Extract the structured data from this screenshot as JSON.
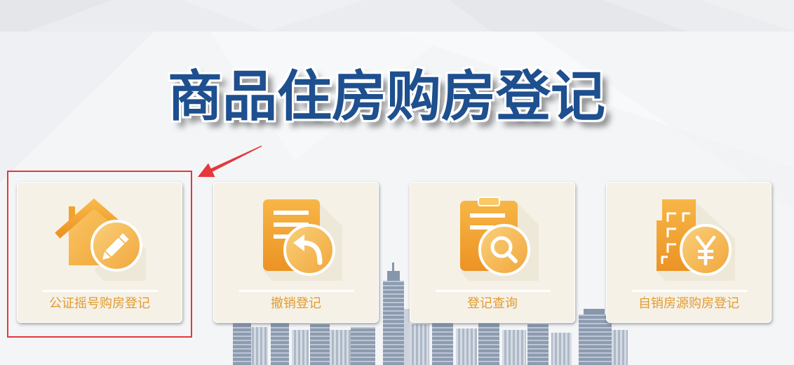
{
  "page": {
    "title": "商品住房购房登记"
  },
  "cards": [
    {
      "label": "公证摇号购房登记",
      "icon": "house-edit-icon",
      "highlighted": true
    },
    {
      "label": "撤销登记",
      "icon": "document-undo-icon",
      "highlighted": false
    },
    {
      "label": "登记查询",
      "icon": "clipboard-search-icon",
      "highlighted": false
    },
    {
      "label": "自销房源购房登记",
      "icon": "building-yuan-icon",
      "highlighted": false
    }
  ],
  "colors": {
    "title": "#1E4F8E",
    "accent": "#EFA22E",
    "label": "#E39B2F",
    "card_background": "#F6F1E6",
    "highlight": "#E5373C"
  }
}
